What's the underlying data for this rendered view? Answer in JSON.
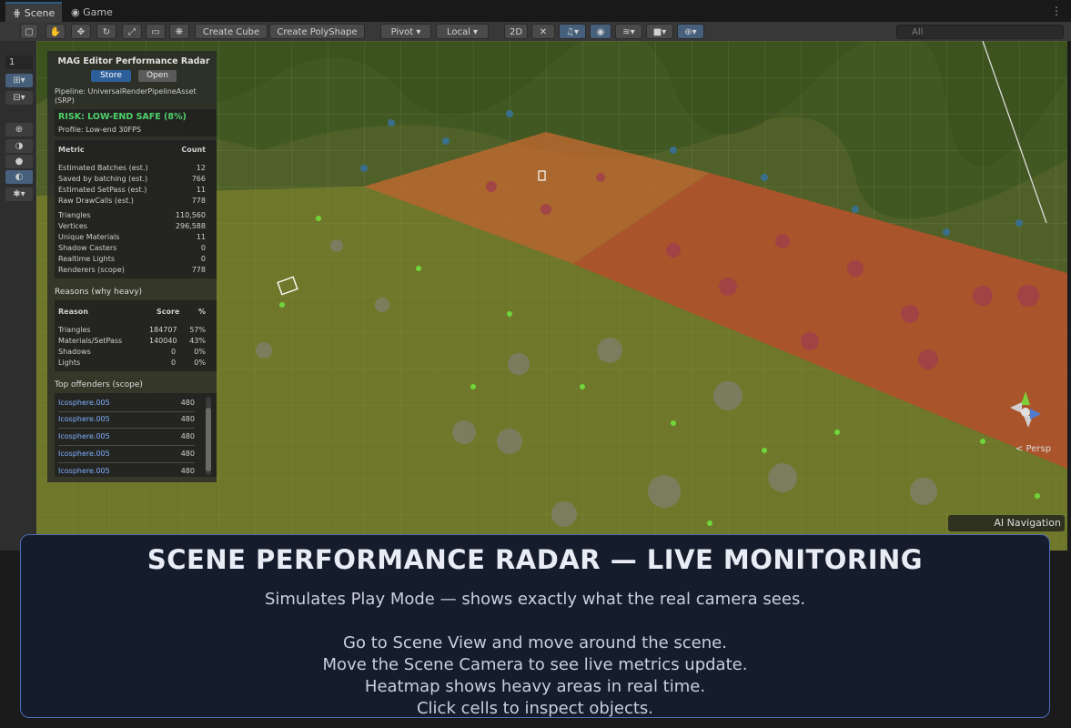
{
  "tabs": [
    {
      "label": "Scene"
    },
    {
      "label": "Game"
    }
  ],
  "toolbar": {
    "create_cube": "Create Cube",
    "create_polyshape": "Create PolyShape",
    "pivot": "Pivot",
    "local": "Local",
    "mode_2d": "2D",
    "search_placeholder": "All"
  },
  "left_tools": {
    "layer_value": "1"
  },
  "panel": {
    "title": "MAG Editor Performance Radar",
    "store_label": "Store",
    "open_label": "Open",
    "pipeline": "Pipeline: UniversalRenderPipelineAsset (SRP)",
    "risk": "RISK: LOW-END SAFE  (8%)",
    "profile": "Profile: Low-end 30FPS",
    "metrics_header": {
      "metric": "Metric",
      "count": "Count"
    },
    "metrics": [
      {
        "label": "Estimated Batches (est.)",
        "value": "12"
      },
      {
        "label": "Saved by batching (est.)",
        "value": "766"
      },
      {
        "label": "Estimated SetPass (est.)",
        "value": "11"
      },
      {
        "label": "Raw DrawCalls (est.)",
        "value": "778"
      },
      {
        "label": "Triangles",
        "value": "110,560"
      },
      {
        "label": "Vertices",
        "value": "296,588"
      },
      {
        "label": "Unique Materials",
        "value": "11"
      },
      {
        "label": "Shadow Casters",
        "value": "0"
      },
      {
        "label": "Realtime Lights",
        "value": "0"
      },
      {
        "label": "Renderers (scope)",
        "value": "778"
      }
    ],
    "reasons_title": "Reasons (why heavy)",
    "reasons_header": {
      "reason": "Reason",
      "score": "Score",
      "pct": "%"
    },
    "reasons": [
      {
        "label": "Triangles",
        "score": "184707",
        "pct": "57%"
      },
      {
        "label": "Materials/SetPass",
        "score": "140040",
        "pct": "43%"
      },
      {
        "label": "Shadows",
        "score": "0",
        "pct": "0%"
      },
      {
        "label": "Lights",
        "score": "0",
        "pct": "0%"
      }
    ],
    "offenders_title": "Top offenders (scope)",
    "offenders": [
      {
        "label": "Icosphere.005",
        "value": "480"
      },
      {
        "label": "Icosphere.005",
        "value": "480"
      },
      {
        "label": "Icosphere.005",
        "value": "480"
      },
      {
        "label": "Icosphere.005",
        "value": "480"
      },
      {
        "label": "Icosphere.005",
        "value": "480"
      }
    ]
  },
  "viewport": {
    "persp": "< Persp",
    "ai_navigation": "AI Navigation"
  },
  "caption": {
    "title": "SCENE PERFORMANCE RADAR — LIVE MONITORING",
    "subtitle": "Simulates Play Mode — shows exactly what the real camera sees.",
    "lines": [
      "Go to Scene View and move around the scene.",
      "Move the Scene Camera to see live metrics update.",
      "Heatmap shows heavy areas in real time.",
      "Click cells to inspect objects."
    ]
  },
  "colors": {
    "accent": "#2c5d87",
    "risk_green": "#4fd16a",
    "heat_red": "#c8502c",
    "heat_orange": "#c86a30",
    "ground": "#5a6b2a"
  }
}
